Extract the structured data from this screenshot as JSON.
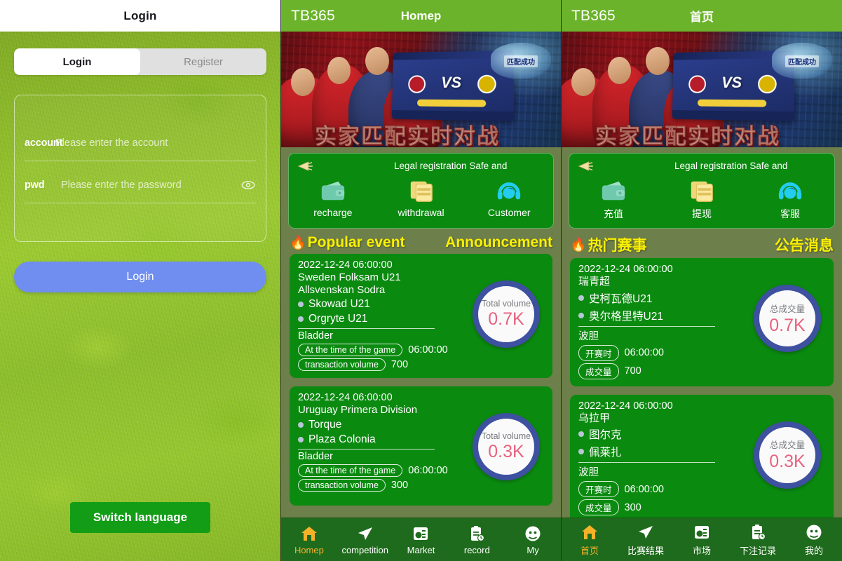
{
  "login": {
    "titlebar": "Login",
    "tabs": [
      {
        "label": "Login",
        "active": true
      },
      {
        "label": "Register",
        "active": false
      }
    ],
    "fields": {
      "account_label": "account",
      "account_placeholder": "Please enter the account",
      "account_value": "",
      "pwd_label": "pwd",
      "pwd_placeholder": "Please enter the password",
      "pwd_value": "",
      "eye_icon": "eye-icon"
    },
    "submit_label": "Login",
    "switch_language_label": "Switch language"
  },
  "app_en": {
    "brand": "TB365",
    "title": "Homep",
    "banner": {
      "badge": "匹配成功",
      "slogan": "实家匹配实时对战",
      "vs": "VS"
    },
    "quick": {
      "megaphone_icon": "megaphone-icon",
      "marquee": "Legal registration Safe and",
      "items": [
        {
          "label": "recharge",
          "icon": "wallet-icon"
        },
        {
          "label": "withdrawal",
          "icon": "cards-icon"
        },
        {
          "label": "Customer",
          "icon": "headset-icon"
        }
      ]
    },
    "sections": {
      "popular": "Popular event",
      "announcement": "Announcement",
      "fire_icon": "fire-icon"
    },
    "cards": [
      {
        "date": "2022-12-24 06:00:00",
        "league": "Sweden Folksam U21 Allsvenskan Sodra",
        "team_home": "Skowad U21",
        "team_away": "Orgryte U21",
        "bet_type": "Bladder",
        "chip_time_label": "At the time of the game",
        "time_value": "06:00:00",
        "chip_volume_label": "transaction volume",
        "volume_value": "700",
        "circle_caption": "Total volume",
        "circle_value": "0.7K"
      },
      {
        "date": "2022-12-24 06:00:00",
        "league": "Uruguay Primera Division",
        "team_home": "Torque",
        "team_away": "Plaza Colonia",
        "bet_type": "Bladder",
        "chip_time_label": "At the time of the game",
        "time_value": "06:00:00",
        "chip_volume_label": "transaction volume",
        "volume_value": "300",
        "circle_caption": "Total volume",
        "circle_value": "0.3K"
      }
    ],
    "tabbar": [
      {
        "label": "Homep",
        "icon": "home-icon",
        "active": true
      },
      {
        "label": "competition",
        "icon": "paper-plane-icon",
        "active": false
      },
      {
        "label": "Market",
        "icon": "market-icon",
        "active": false
      },
      {
        "label": "record",
        "icon": "clipboard-clock-icon",
        "active": false
      },
      {
        "label": "My",
        "icon": "profile-face-icon",
        "active": false
      }
    ]
  },
  "app_zh": {
    "brand": "TB365",
    "title": "首页",
    "banner": {
      "badge": "匹配成功",
      "slogan": "实家匹配实时对战",
      "vs": "VS"
    },
    "quick": {
      "megaphone_icon": "megaphone-icon",
      "marquee": "Legal registration Safe and",
      "items": [
        {
          "label": "充值",
          "icon": "wallet-icon"
        },
        {
          "label": "提现",
          "icon": "cards-icon"
        },
        {
          "label": "客服",
          "icon": "headset-icon"
        }
      ]
    },
    "sections": {
      "popular": "热门赛事",
      "announcement": "公告消息",
      "fire_icon": "fire-icon"
    },
    "cards": [
      {
        "date": "2022-12-24 06:00:00",
        "league": "瑞青超",
        "team_home": "史柯瓦德U21",
        "team_away": "奥尔格里特U21",
        "bet_type": "波胆",
        "chip_time_label": "开赛时",
        "time_value": "06:00:00",
        "chip_volume_label": "成交量",
        "volume_value": "700",
        "circle_caption": "总成交量",
        "circle_value": "0.7K"
      },
      {
        "date": "2022-12-24 06:00:00",
        "league": "乌拉甲",
        "team_home": "图尔克",
        "team_away": "佩莱扎",
        "bet_type": "波胆",
        "chip_time_label": "开赛时",
        "time_value": "06:00:00",
        "chip_volume_label": "成交量",
        "volume_value": "300",
        "circle_caption": "总成交量",
        "circle_value": "0.3K"
      }
    ],
    "tabbar": [
      {
        "label": "首页",
        "icon": "home-icon",
        "active": true
      },
      {
        "label": "比赛结果",
        "icon": "paper-plane-icon",
        "active": false
      },
      {
        "label": "市场",
        "icon": "market-icon",
        "active": false
      },
      {
        "label": "下注记录",
        "icon": "clipboard-clock-icon",
        "active": false
      },
      {
        "label": "我的",
        "icon": "profile-face-icon",
        "active": false
      }
    ]
  },
  "colors": {
    "header_green": "#6bb32a",
    "card_green": "#0b8a10",
    "page_green": "#6d7f4a",
    "tabbar_green": "#1f6b1d",
    "accent_yellow": "#fbf000",
    "accent_orange": "#f5b229",
    "circle_ring": "#3e50a0",
    "circle_number": "#e8637e",
    "login_button_blue": "#6f8ef0",
    "switch_language_green": "#139d17"
  }
}
